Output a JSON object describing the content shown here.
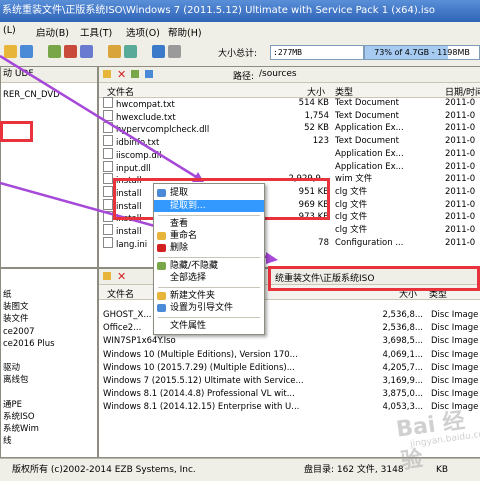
{
  "window": {
    "title": "系统重装文件\\正版系统ISO\\Windows 7 (2011.5.12) Ultimate with Service Pack 1 (x64).iso"
  },
  "menu": [
    "(L)",
    "启动(B)",
    "工具(T)",
    "选项(O)",
    "帮助(H)"
  ],
  "toolbar": {
    "size_label": "大小总计:",
    "size_value": ":277MB",
    "progress_text": "73% of 4.7GB - 1198MB free",
    "progress_pct": 73
  },
  "upper_left": {
    "header": "动 UDF",
    "tree_item": "RER_CN_DVD"
  },
  "upper_right": {
    "path_label": "路径:",
    "path_value": "/sources",
    "columns": [
      "文件名",
      "大小",
      "类型",
      "日期/时间"
    ],
    "rows": [
      {
        "name": "hwcompat.txt",
        "size": "514 KB",
        "type": "Text Document",
        "date": "2011-0"
      },
      {
        "name": "hwexclude.txt",
        "size": "1,754",
        "type": "Text Document",
        "date": "2011-0"
      },
      {
        "name": "hypervcomplcheck.dll",
        "size": "52 KB",
        "type": "Application Ex...",
        "date": "2011-0"
      },
      {
        "name": "idbinfo.txt",
        "size": "123",
        "type": "Text Document",
        "date": "2011-0"
      },
      {
        "name": "iiscomp.dll",
        "size": "",
        "type": "Application Ex...",
        "date": "2011-0"
      },
      {
        "name": "input.dll",
        "size": "",
        "type": "Application Ex...",
        "date": "2011-0"
      },
      {
        "name": "install",
        "size": "2,929,9...",
        "type": "wim 文件",
        "date": "2011-0"
      },
      {
        "name": "install",
        "size": "951 KB",
        "type": "clg 文件",
        "date": "2011-0"
      },
      {
        "name": "install",
        "size": "969 KB",
        "type": "clg 文件",
        "date": "2011-0"
      },
      {
        "name": "install",
        "size": "973 KB",
        "type": "clg 文件",
        "date": "2011-0"
      },
      {
        "name": "install",
        "size": "",
        "type": "clg 文件",
        "date": "2011-0"
      },
      {
        "name": "lang.ini",
        "size": "78",
        "type": "Configuration ...",
        "date": "2011-0"
      }
    ]
  },
  "lower_left": {
    "tree": [
      "纸",
      "装图文",
      "装文件",
      "ce2007",
      "ce2016 Plus",
      "",
      "驱动",
      "离线包",
      "",
      "通PE",
      "系统ISO",
      "系统Wim",
      "线"
    ]
  },
  "lower_right": {
    "path_value": "统重装文件\\正版系统ISO",
    "columns": [
      "文件名",
      "大小",
      "类型"
    ],
    "rows": [
      {
        "name": "GHOST_X...",
        "size": "2,536,8...",
        "type": "Disc Image"
      },
      {
        "name": "Office2...",
        "size": "2,536,8...",
        "type": "Disc Image"
      },
      {
        "name": "WIN7SP1x64Y.Iso",
        "size": "3,698,5...",
        "type": "Disc Image"
      },
      {
        "name": "Windows 10 (Multiple Editions), Version 170...",
        "size": "4,069,1...",
        "type": "Disc Image"
      },
      {
        "name": "Windows 10 (2015.7.29) (Multiple Editions)...",
        "size": "4,205,7...",
        "type": "Disc Image"
      },
      {
        "name": "Windows 7 (2015.5.12) Ultimate with Service...",
        "size": "3,169,9...",
        "type": "Disc Image"
      },
      {
        "name": "Windows 8.1 (2014.4.8) Professional VL wit...",
        "size": "3,875,0...",
        "type": "Disc Image"
      },
      {
        "name": "Windows 8.1 (2014.12.15) Enterprise with U...",
        "size": "4,053,3...",
        "type": "Disc Image"
      }
    ]
  },
  "context_menu": {
    "items": [
      "提取",
      "提取到...",
      "查看",
      "重命名",
      "删除",
      "隐藏/不隐藏",
      "全部选择",
      "新建文件夹",
      "设置为引导文件",
      "文件属性"
    ]
  },
  "status": {
    "copyright": "版权所有 (c)2002-2014 EZB Systems, Inc.",
    "disk_info": "盘目录: 162 文件, 3148",
    "kb": "KB"
  },
  "watermark": {
    "brand": "Bai 经验",
    "url": "jingyan.baidu.com"
  },
  "colors": {
    "highlight": "#3399ff",
    "red_box": "#e8323c",
    "arrow": "#a648d8"
  }
}
